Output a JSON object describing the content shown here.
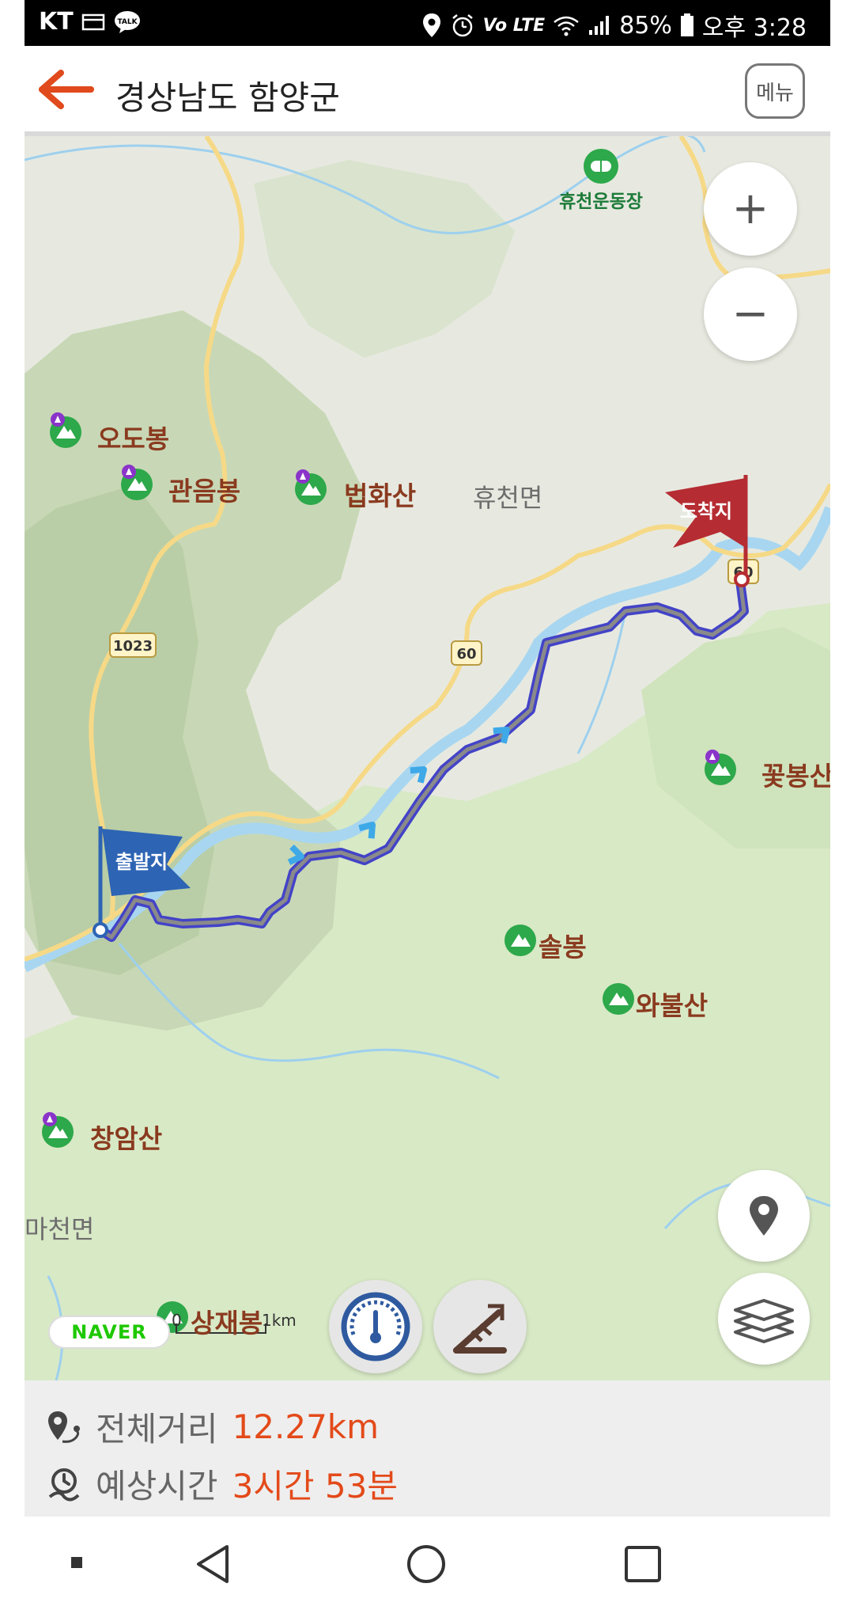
{
  "status_bar": {
    "carrier": "KT",
    "battery": "85%",
    "time": "오후 3:28",
    "icons": [
      "sim-icon",
      "kakaotalk-icon",
      "location-icon",
      "alarm-icon",
      "volte-icon",
      "wifi-icon",
      "signal-icon",
      "battery-icon"
    ],
    "talk_badge": "TALK",
    "volte_text": "Vo LTE"
  },
  "header": {
    "back_icon": "arrow-left-icon",
    "title": "경상남도 함양군",
    "menu_label": "메뉴",
    "accent_color": "#e04a1c"
  },
  "map": {
    "start_flag": "출발지",
    "end_flag": "도착지",
    "road_numbers": [
      "1023",
      "60",
      "60"
    ],
    "poi": "휴천운동장",
    "peaks": [
      "오도봉",
      "관음봉",
      "법화산",
      "꽃봉산",
      "솔봉",
      "와불산",
      "창암산",
      "상재봉"
    ],
    "areas": [
      "휴천면",
      "마천면"
    ],
    "zoom_in": "+",
    "zoom_out": "−",
    "naver_logo": "NAVER",
    "scale_start": "0",
    "scale_end": "1km",
    "route_color": "#4343c8",
    "start_color": "#2d64b4",
    "end_color": "#b52c32"
  },
  "controls": [
    "zoom-in-button",
    "zoom-out-button",
    "speedometer-button",
    "slope-button",
    "my-location-button",
    "layers-button"
  ],
  "summary": {
    "distance_label": "전체거리",
    "distance_value": "12.27km",
    "time_label": "예상시간",
    "time_value": "3시간 53분"
  },
  "nav": {
    "items": [
      "recent-button",
      "back-nav-button",
      "home-button",
      "overview-button"
    ]
  }
}
